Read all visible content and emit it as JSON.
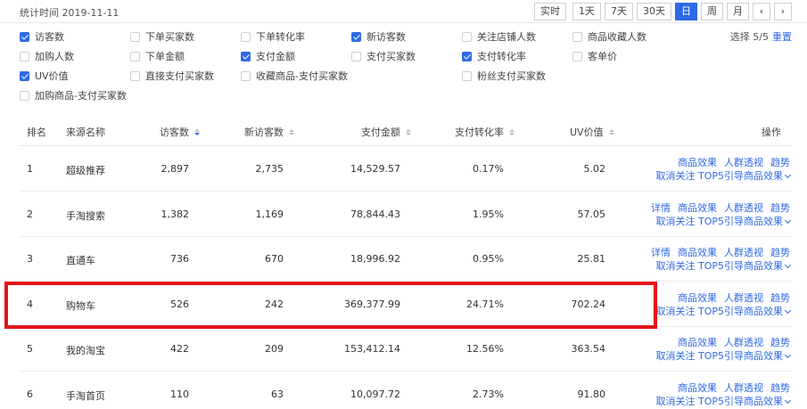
{
  "header": {
    "stat_time": "统计时间 2019-11-11",
    "range_buttons": [
      "实时",
      "1天",
      "7天",
      "30天",
      "日",
      "周",
      "月"
    ],
    "active_range": "日",
    "prev_icon": "chevron-left-icon",
    "next_icon": "chevron-right-icon"
  },
  "metrics": [
    [
      {
        "label": "访客数",
        "checked": true
      },
      {
        "label": "下单买家数",
        "checked": false
      },
      {
        "label": "下单转化率",
        "checked": false
      },
      {
        "label": "新访客数",
        "checked": true
      },
      {
        "label": "关注店铺人数",
        "checked": false
      },
      {
        "label": "商品收藏人数",
        "checked": false
      }
    ],
    [
      {
        "label": "加购人数",
        "checked": false
      },
      {
        "label": "下单金额",
        "checked": false
      },
      {
        "label": "支付金额",
        "checked": true
      },
      {
        "label": "支付买家数",
        "checked": false
      },
      {
        "label": "支付转化率",
        "checked": true
      },
      {
        "label": "客单价",
        "checked": false
      }
    ],
    [
      {
        "label": "UV价值",
        "checked": true
      },
      {
        "label": "直接支付买家数",
        "checked": false
      },
      {
        "label": "收藏商品-支付买家数",
        "checked": false
      },
      {
        "label": "粉丝支付买家数",
        "checked": false
      }
    ],
    [
      {
        "label": "加购商品-支付买家数",
        "checked": false
      }
    ]
  ],
  "selection": {
    "text": "选择 5/5",
    "reset_label": "重置"
  },
  "table": {
    "columns": [
      "排名",
      "来源名称",
      "访客数",
      "新访客数",
      "支付金额",
      "支付转化率",
      "UV价值",
      "操作"
    ],
    "rows": [
      {
        "rank": "1",
        "name": "超级推荐",
        "visitors": "2,897",
        "new_visitors": "2,735",
        "amount": "14,529.57",
        "conversion": "0.17%",
        "uv_value": "5.02",
        "ops1": [
          "商品效果",
          "人群透视",
          "趋势"
        ],
        "ops2": "取消关注 TOP5引导商品效果"
      },
      {
        "rank": "2",
        "name": "手淘搜索",
        "visitors": "1,382",
        "new_visitors": "1,169",
        "amount": "78,844.43",
        "conversion": "1.95%",
        "uv_value": "57.05",
        "ops1": [
          "详情",
          "商品效果",
          "人群透视",
          "趋势"
        ],
        "ops2": "取消关注 TOP5引导商品效果"
      },
      {
        "rank": "3",
        "name": "直通车",
        "visitors": "736",
        "new_visitors": "670",
        "amount": "18,996.92",
        "conversion": "0.95%",
        "uv_value": "25.81",
        "ops1": [
          "详情",
          "商品效果",
          "人群透视",
          "趋势"
        ],
        "ops2": "取消关注 TOP5引导商品效果"
      },
      {
        "rank": "4",
        "name": "购物车",
        "visitors": "526",
        "new_visitors": "242",
        "amount": "369,377.99",
        "conversion": "24.71%",
        "uv_value": "702.24",
        "ops1": [
          "商品效果",
          "人群透视",
          "趋势"
        ],
        "ops2": "取消关注 TOP5引导商品效果"
      },
      {
        "rank": "5",
        "name": "我的淘宝",
        "visitors": "422",
        "new_visitors": "209",
        "amount": "153,412.14",
        "conversion": "12.56%",
        "uv_value": "363.54",
        "ops1": [
          "商品效果",
          "人群透视",
          "趋势"
        ],
        "ops2": "取消关注 TOP5引导商品效果"
      },
      {
        "rank": "6",
        "name": "手淘首页",
        "visitors": "110",
        "new_visitors": "63",
        "amount": "10,097.72",
        "conversion": "2.73%",
        "uv_value": "91.80",
        "ops1": [
          "商品效果",
          "人群透视",
          "趋势"
        ],
        "ops2": "取消关注 TOP5引导商品效果"
      }
    ]
  },
  "colors": {
    "accent": "#2e6ae6",
    "highlight": "#e2141a"
  }
}
